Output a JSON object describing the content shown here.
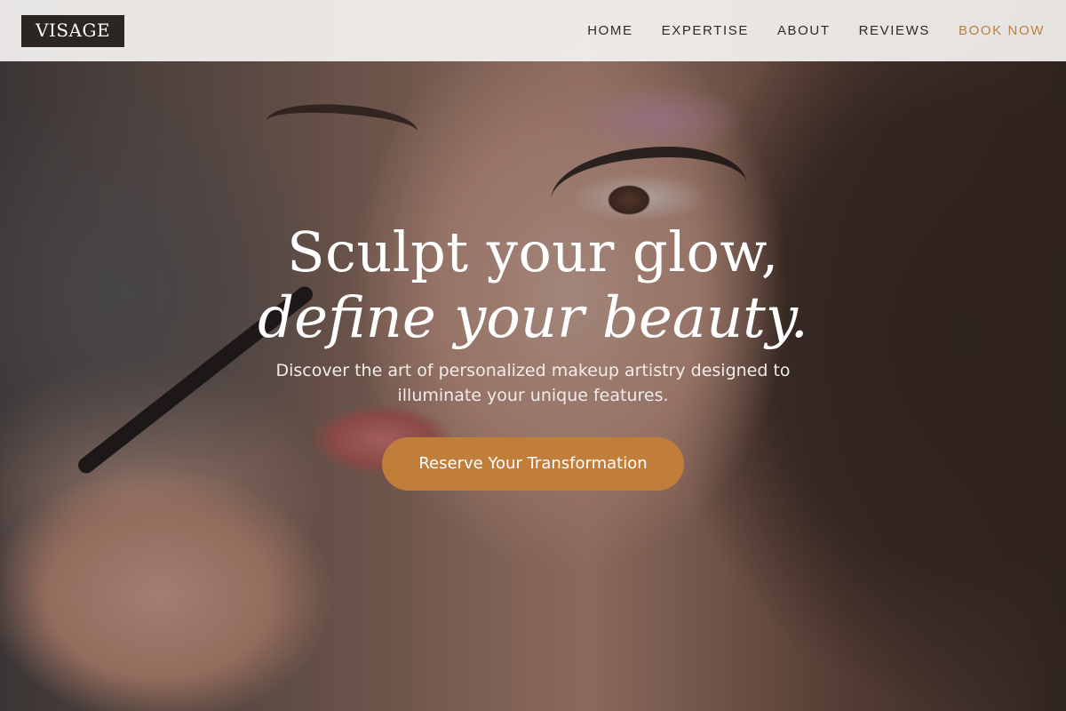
{
  "header": {
    "logo": "VISAGE",
    "nav": {
      "home": "HOME",
      "expertise": "EXPERTISE",
      "about": "ABOUT",
      "reviews": "REVIEWS",
      "book": "BOOK NOW"
    }
  },
  "hero": {
    "headline_line1": "Sculpt your glow,",
    "headline_line2": "define your beauty.",
    "subtext": "Discover the art of personalized makeup artistry designed to illuminate your unique features.",
    "cta_label": "Reserve Your Transformation"
  },
  "colors": {
    "accent": "#c17d3a",
    "book_link": "#b9813f",
    "logo_bg": "#2b2624",
    "header_bg": "#f4f2f0"
  }
}
